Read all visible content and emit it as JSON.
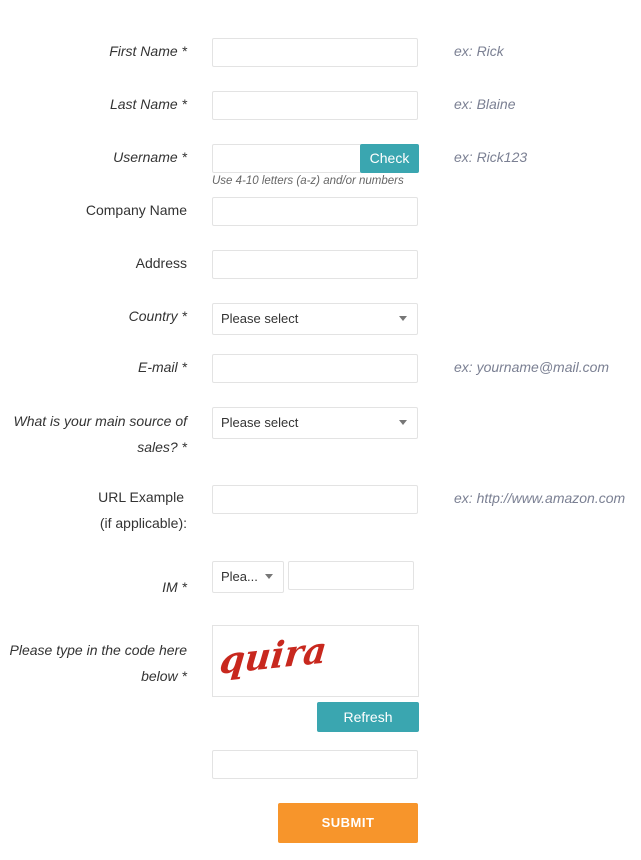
{
  "fields": {
    "first_name": {
      "label": "First Name *",
      "example": "ex: Rick"
    },
    "last_name": {
      "label": "Last Name *",
      "example": "ex: Blaine"
    },
    "username": {
      "label": "Username *",
      "example": "ex: Rick123",
      "check_label": "Check",
      "hint": "Use 4-10 letters (a-z) and/or numbers"
    },
    "company": {
      "label": "Company Name"
    },
    "address": {
      "label": "Address"
    },
    "country": {
      "label": "Country *",
      "selected": "Please select"
    },
    "email": {
      "label": "E-mail *",
      "example": "ex: yourname@mail.com"
    },
    "sales_source": {
      "label_line1": "What is your main source of",
      "label_line2": "sales? *",
      "selected": "Please select"
    },
    "url": {
      "label_line1": "URL Example",
      "label_line2": "(if applicable):",
      "example": "ex: http://www.amazon.com"
    },
    "im": {
      "label": "IM *",
      "selected": "Plea..."
    },
    "captcha": {
      "label_line1": "Please type in the code here",
      "label_line2": "below *",
      "code_text": "quira",
      "refresh_label": "Refresh"
    }
  },
  "submit_label": "SUBMIT",
  "colors": {
    "teal": "#3aa6b0",
    "orange": "#f7952b",
    "captcha_red": "#c8281e"
  }
}
